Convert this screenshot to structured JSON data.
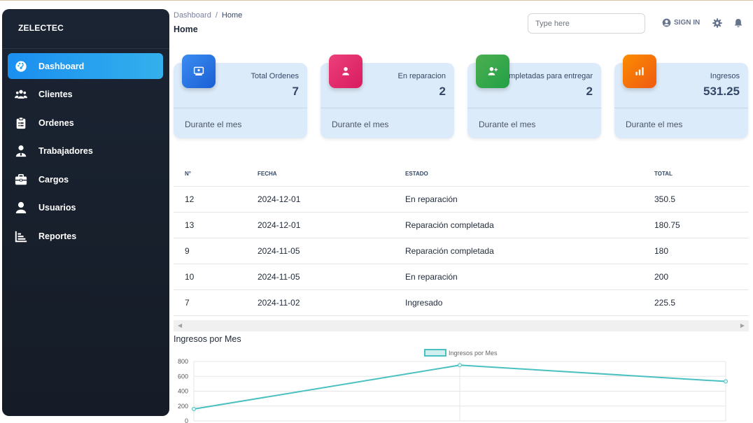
{
  "brand": "ZELECTEC",
  "sidebar": {
    "items": [
      {
        "label": "Dashboard",
        "icon": "dashboard-icon"
      },
      {
        "label": "Clientes",
        "icon": "users-icon"
      },
      {
        "label": "Ordenes",
        "icon": "clipboard-icon"
      },
      {
        "label": "Trabajadores",
        "icon": "worker-icon"
      },
      {
        "label": "Cargos",
        "icon": "briefcase-icon"
      },
      {
        "label": "Usuarios",
        "icon": "user-icon"
      },
      {
        "label": "Reportes",
        "icon": "chart-bar-icon"
      }
    ]
  },
  "header": {
    "breadcrumb_root": "Dashboard",
    "breadcrumb_sep": "/",
    "breadcrumb_current": "Home",
    "title": "Home",
    "search_placeholder": "Type here",
    "signin_label": "SIGN IN"
  },
  "cards": [
    {
      "label": "Total Ordenes",
      "value": "7",
      "footer": "Durante el mes",
      "color": "#1a73e8"
    },
    {
      "label": "En reparacion",
      "value": "2",
      "footer": "Durante el mes",
      "color": "#e91e63"
    },
    {
      "label": "Completadas para entregar",
      "value": "2",
      "footer": "Durante el mes",
      "color": "#2fb84e"
    },
    {
      "label": "Ingresos",
      "value": "531.25",
      "footer": "Durante el mes",
      "color": "#f26a12"
    }
  ],
  "table": {
    "headers": [
      "N°",
      "FECHA",
      "ESTADO",
      "TOTAL"
    ],
    "rows": [
      [
        "12",
        "2024-12-01",
        "En reparación",
        "350.5"
      ],
      [
        "13",
        "2024-12-01",
        "Reparación completada",
        "180.75"
      ],
      [
        "9",
        "2024-11-05",
        "Reparación completada",
        "180"
      ],
      [
        "10",
        "2024-11-05",
        "En reparación",
        "200"
      ],
      [
        "7",
        "2024-11-02",
        "Ingresado",
        "225.5"
      ]
    ]
  },
  "chart_title": "Ingresos por Mes",
  "chart_data": {
    "type": "line",
    "legend": "top-center",
    "grid": true,
    "ylim": [
      0,
      800
    ],
    "yticks": [
      0,
      200,
      400,
      600,
      800
    ],
    "series": [
      {
        "name": "Ingresos por Mes",
        "values": [
          160,
          750,
          531.25
        ],
        "color": "#4bc0c0"
      }
    ]
  }
}
